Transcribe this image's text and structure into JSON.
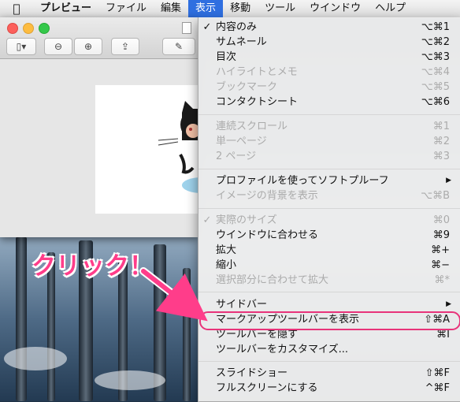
{
  "menubar": {
    "items": [
      {
        "label": "プレビュー"
      },
      {
        "label": "ファイル"
      },
      {
        "label": "編集"
      },
      {
        "label": "表示"
      },
      {
        "label": "移動"
      },
      {
        "label": "ツール"
      },
      {
        "label": "ウインドウ"
      },
      {
        "label": "ヘルプ"
      }
    ]
  },
  "view_menu": {
    "items": [
      {
        "check": "✓",
        "label": "内容のみ",
        "shortcut": "⌥⌘1",
        "enabled": true
      },
      {
        "label": "サムネール",
        "shortcut": "⌥⌘2",
        "enabled": true
      },
      {
        "label": "目次",
        "shortcut": "⌥⌘3",
        "enabled": true
      },
      {
        "label": "ハイライトとメモ",
        "shortcut": "⌥⌘4",
        "enabled": false
      },
      {
        "label": "ブックマーク",
        "shortcut": "⌥⌘5",
        "enabled": false
      },
      {
        "label": "コンタクトシート",
        "shortcut": "⌥⌘6",
        "enabled": true
      },
      {
        "label": "連続スクロール",
        "shortcut": "⌘1",
        "enabled": false
      },
      {
        "label": "単一ページ",
        "shortcut": "⌘2",
        "enabled": false
      },
      {
        "label": "2 ページ",
        "shortcut": "⌘3",
        "enabled": false
      },
      {
        "label": "プロファイルを使ってソフトプルーフ",
        "shortcut": "▶",
        "enabled": true
      },
      {
        "label": "イメージの背景を表示",
        "shortcut": "⌥⌘B",
        "enabled": false
      },
      {
        "check": "✓",
        "label": "実際のサイズ",
        "shortcut": "⌘0",
        "enabled": false
      },
      {
        "label": "ウインドウに合わせる",
        "shortcut": "⌘9",
        "enabled": true
      },
      {
        "label": "拡大",
        "shortcut": "⌘+",
        "enabled": true
      },
      {
        "label": "縮小",
        "shortcut": "⌘−",
        "enabled": true
      },
      {
        "label": "選択部分に合わせて拡大",
        "shortcut": "⌘*",
        "enabled": false
      },
      {
        "label": "サイドバー",
        "shortcut": "▶",
        "enabled": true
      },
      {
        "label": "マークアップツールバーを表示",
        "shortcut": "⇧⌘A",
        "enabled": true
      },
      {
        "label": "ツールバーを隠す",
        "shortcut": "⌘I",
        "enabled": true
      },
      {
        "label": "ツールバーをカスタマイズ...",
        "shortcut": "",
        "enabled": true
      },
      {
        "label": "スライドショー",
        "shortcut": "⇧⌘F",
        "enabled": true
      },
      {
        "label": "フルスクリーンにする",
        "shortcut": "^⌘F",
        "enabled": true
      }
    ]
  },
  "annotation": {
    "callout": "クリック！",
    "color": "#ff3d8a"
  },
  "colors": {
    "menu_highlight": "#2f6fe0",
    "ring": "#e8337a"
  },
  "icons": [
    "apple-icon",
    "sidebar-icon",
    "zoom-out-icon",
    "zoom-in-icon",
    "share-icon",
    "markup-pen-icon"
  ]
}
